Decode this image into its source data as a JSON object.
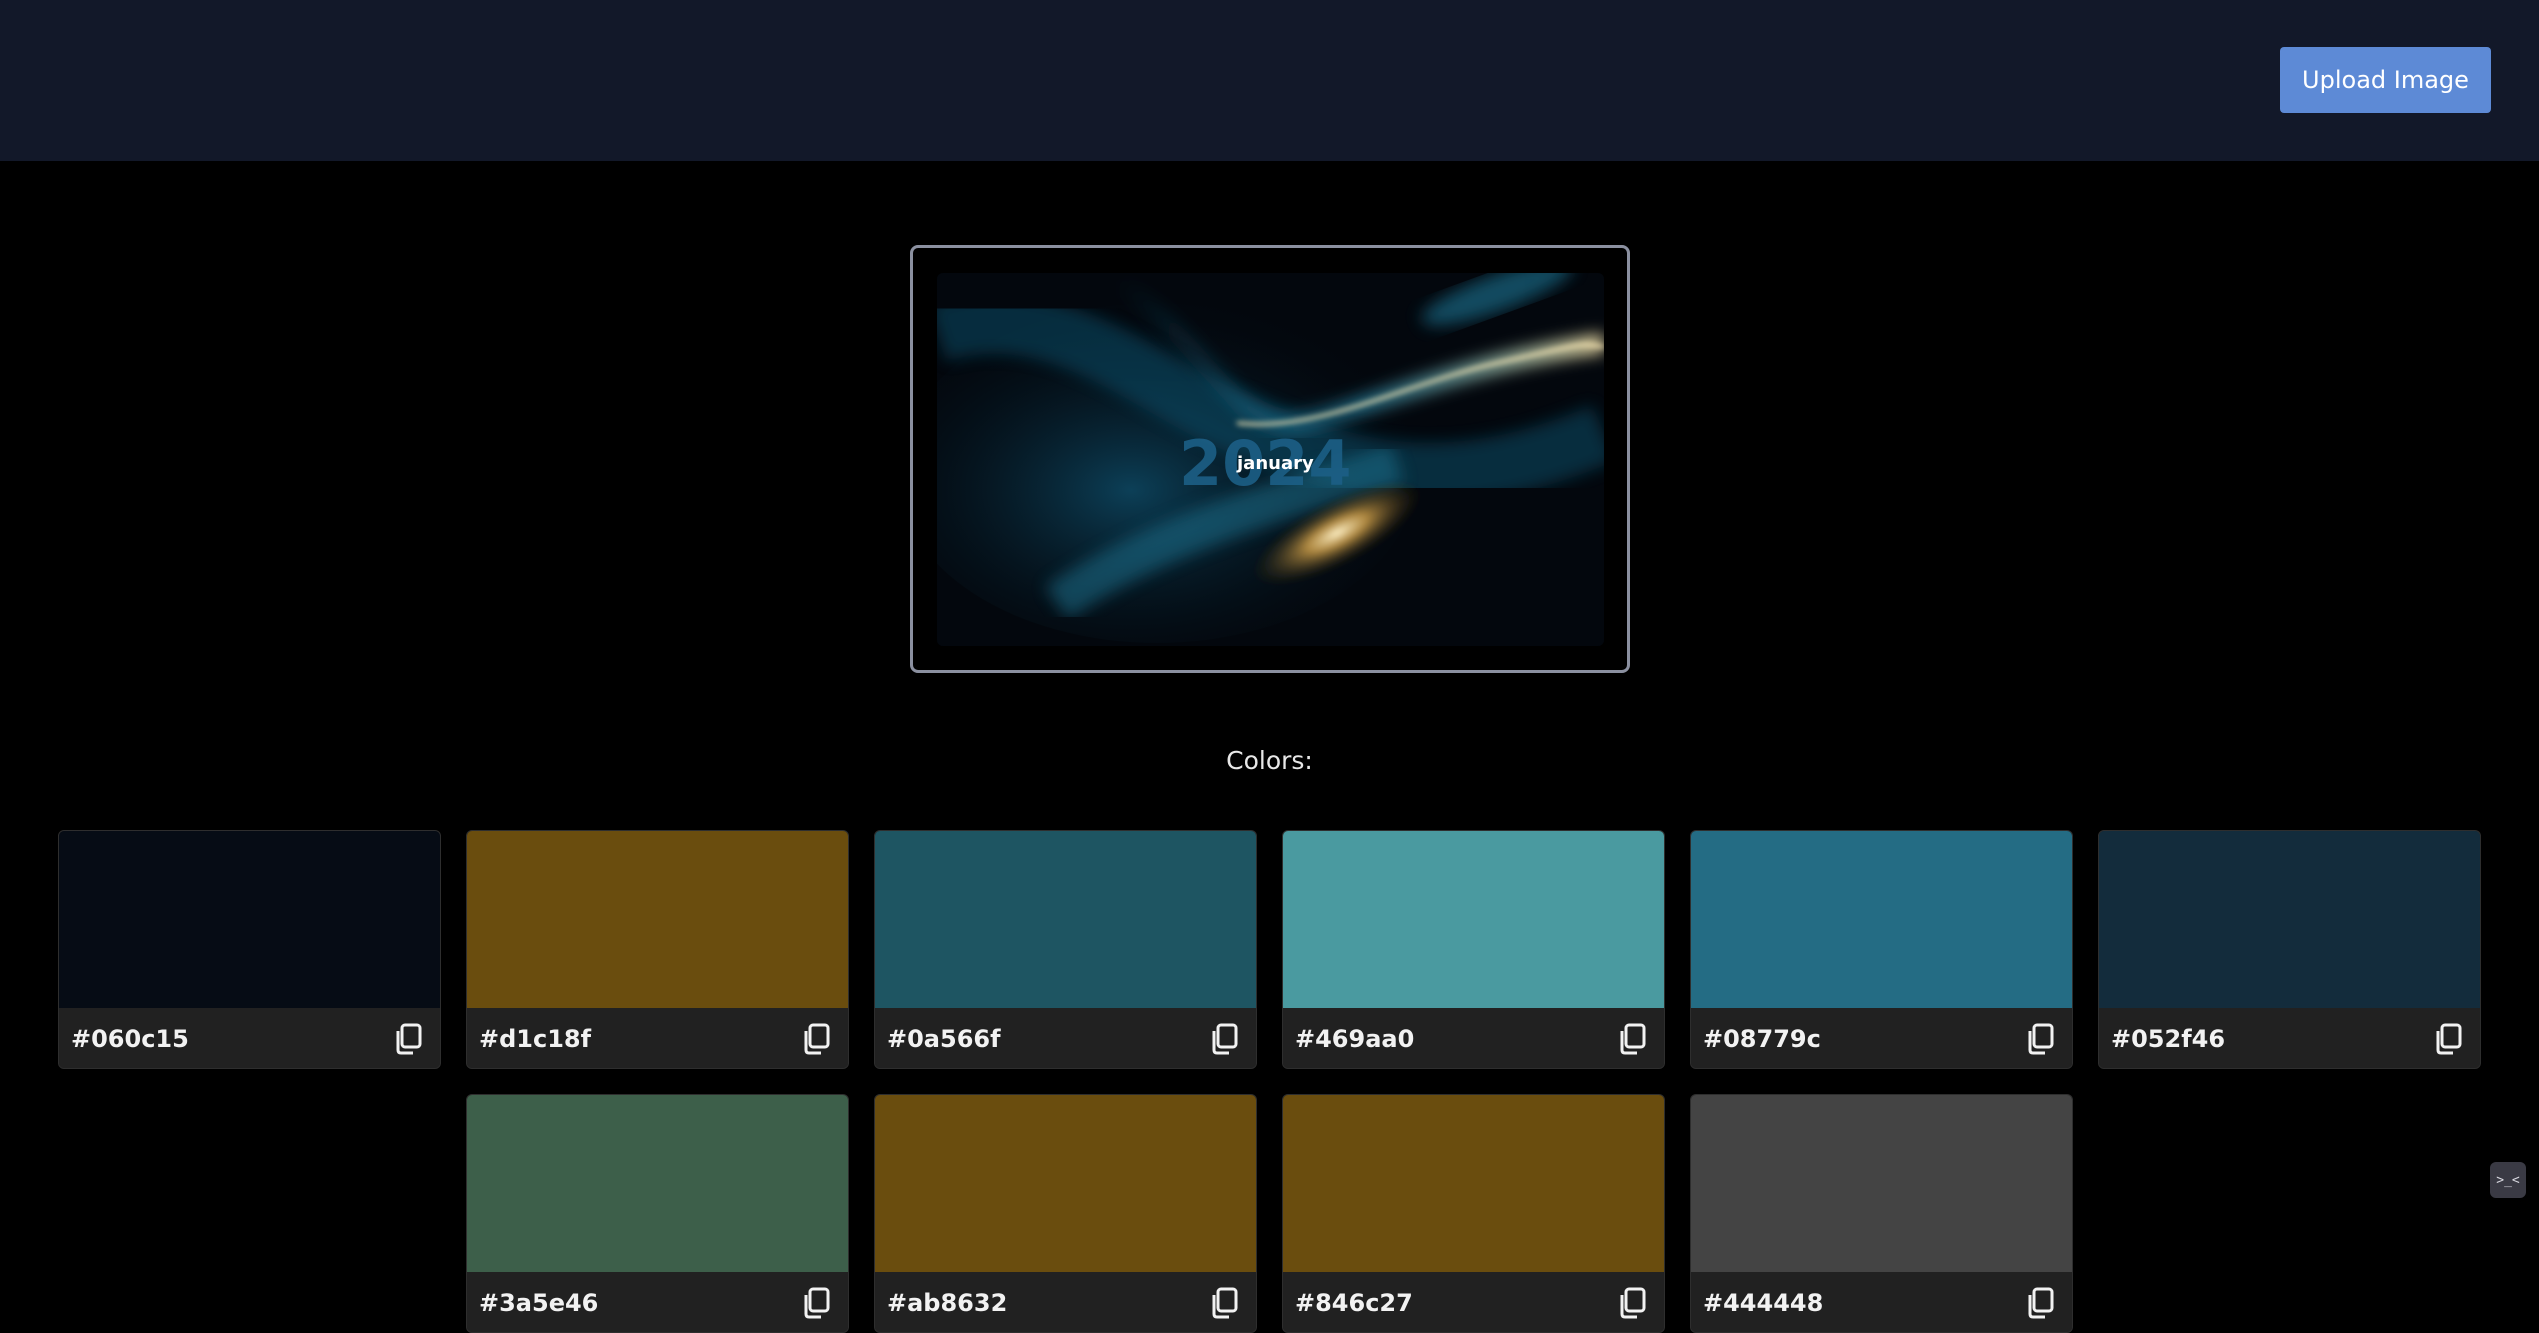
{
  "header": {
    "upload_label": "Upload Image"
  },
  "preview": {
    "year_text": "2024",
    "month_text": "january"
  },
  "colors_heading": "Colors:",
  "swatches": [
    {
      "hex": "#060c15",
      "color": "#060c15"
    },
    {
      "hex": "#d1c18f",
      "color": "#6a4d0e"
    },
    {
      "hex": "#0a566f",
      "color": "#1e5562"
    },
    {
      "hex": "#469aa0",
      "color": "#4a9aa0"
    },
    {
      "hex": "#08779c",
      "color": "#246c84"
    },
    {
      "hex": "#052f46",
      "color": "#132c3c"
    },
    {
      "hex": "#3a5e46",
      "color": "#3d5f4a"
    },
    {
      "hex": "#ab8632",
      "color": "#6a4d0e"
    },
    {
      "hex": "#846c27",
      "color": "#6a4d0e"
    },
    {
      "hex": "#444448",
      "color": "#444444"
    }
  ],
  "widget": {
    "glyph": ">_<"
  }
}
